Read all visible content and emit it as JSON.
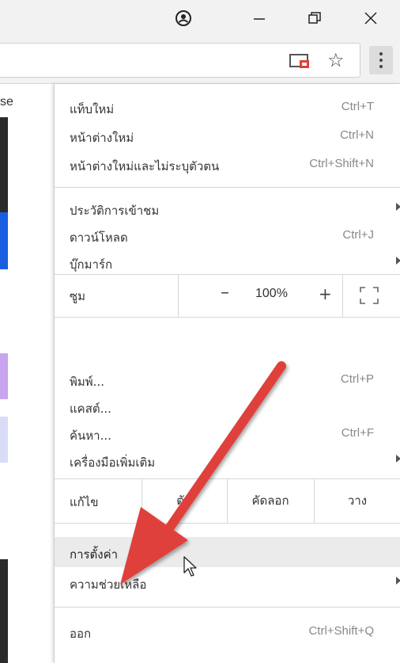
{
  "window": {
    "profile_icon": "profile-icon",
    "minimize_icon": "minimize-icon",
    "maximize_icon": "maximize-icon",
    "close_icon": "close-icon"
  },
  "toolbar": {
    "cast_icon": "cast-icon",
    "bookmark_icon": "star-icon",
    "menu_icon": "more-vertical-icon"
  },
  "page": {
    "fragment_text": "se"
  },
  "menu": {
    "group1": [
      {
        "label": "แท็บใหม่",
        "shortcut": "Ctrl+T"
      },
      {
        "label": "หน้าต่างใหม่",
        "shortcut": "Ctrl+N"
      },
      {
        "label": "หน้าต่างใหม่และไม่ระบุตัวตน",
        "shortcut": "Ctrl+Shift+N"
      }
    ],
    "group2": [
      {
        "label": "ประวัติการเข้าชม",
        "shortcut": ""
      },
      {
        "label": "ดาวน์โหลด",
        "shortcut": "Ctrl+J"
      },
      {
        "label": "บุ๊กมาร์ก",
        "shortcut": ""
      }
    ],
    "zoom": {
      "label": "ซูม",
      "minus": "–",
      "value": "100%",
      "plus": "+"
    },
    "group3": [
      {
        "label": "พิมพ์...",
        "shortcut": "Ctrl+P"
      },
      {
        "label": "แคสต์...",
        "shortcut": ""
      },
      {
        "label": "ค้นหา...",
        "shortcut": "Ctrl+F"
      },
      {
        "label": "เครื่องมือเพิ่มเติม",
        "shortcut": ""
      }
    ],
    "edit": {
      "label": "แก้ไข",
      "cut": "ตัด",
      "copy": "คัดลอก",
      "paste": "วาง"
    },
    "group4": [
      {
        "label": "การตั้งค่า",
        "shortcut": ""
      },
      {
        "label": "ความช่วยเหลือ",
        "shortcut": ""
      }
    ],
    "exit": {
      "label": "ออก",
      "shortcut": "Ctrl+Shift+Q"
    }
  },
  "colors": {
    "annotation_arrow": "#e0403a",
    "strip_blue": "#1a5fe0",
    "strip_purple": "#c9a5f0",
    "strip_lavender": "#d8dcf6"
  }
}
